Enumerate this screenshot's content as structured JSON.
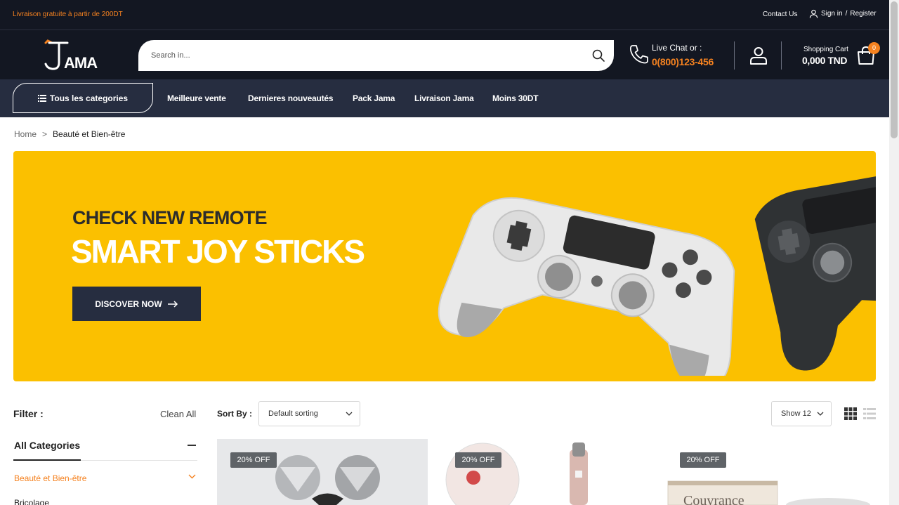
{
  "topbar": {
    "promo": "Livraison gratuite à partir de 200DT",
    "contact": "Contact Us",
    "signin": "Sign in",
    "separator": "/",
    "register": "Register"
  },
  "header": {
    "logo_text": "JAMA",
    "search_placeholder": "Search in...",
    "livechat_label": "Live Chat",
    "livechat_or": "or :",
    "phone": "0(800)123-456",
    "cart_label": "Shopping Cart",
    "cart_total": "0,000 TND",
    "cart_count": "0"
  },
  "nav": {
    "categories_button": "Tous les categories",
    "links": [
      "Meilleure vente",
      "Dernieres nouveautés",
      "Pack Jama",
      "Livraison Jama",
      "Moins 30DT"
    ]
  },
  "breadcrumb": {
    "home": "Home",
    "separator": ">",
    "current": "Beauté et Bien-être"
  },
  "banner": {
    "subtitle": "CHECK NEW REMOTE",
    "title": "SMART JOY STICKS",
    "cta": "DISCOVER NOW"
  },
  "filter": {
    "title": "Filter :",
    "clean_all": "Clean All",
    "categories_title": "All Categories",
    "categories": [
      "Beauté et Bien-être",
      "Bricolage"
    ]
  },
  "toolbar": {
    "sort_label": "Sort By :",
    "sort_value": "Default sorting",
    "show_value": "Show 12"
  },
  "products": [
    {
      "badge": "20% OFF"
    },
    {
      "badge": "20% OFF"
    },
    {
      "badge": "20% OFF",
      "label_text": "Couvrance"
    }
  ],
  "colors": {
    "accent": "#f58220",
    "header_bg": "#131722",
    "nav_bg": "#262d40",
    "banner_bg": "#fbc000"
  }
}
